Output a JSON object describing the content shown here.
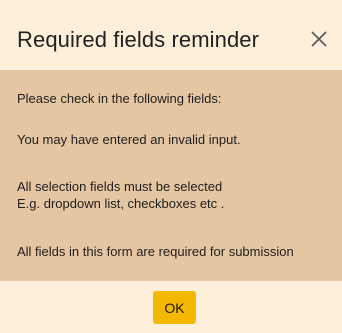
{
  "dialog": {
    "title": "Required fields reminder",
    "close_icon": "close-icon",
    "body": {
      "intro": "Please check in the following fields:",
      "invalid_input": "You may have entered an invalid input.",
      "selection_required": "All selection fields must be selected",
      "selection_example": "E.g. dropdown list, checkboxes etc .",
      "all_required": "All fields in this form are required for submission"
    },
    "ok_label": "OK"
  },
  "colors": {
    "background": "#fdefd9",
    "body_background": "#e6c6a2",
    "ok_button": "#f5b800"
  }
}
